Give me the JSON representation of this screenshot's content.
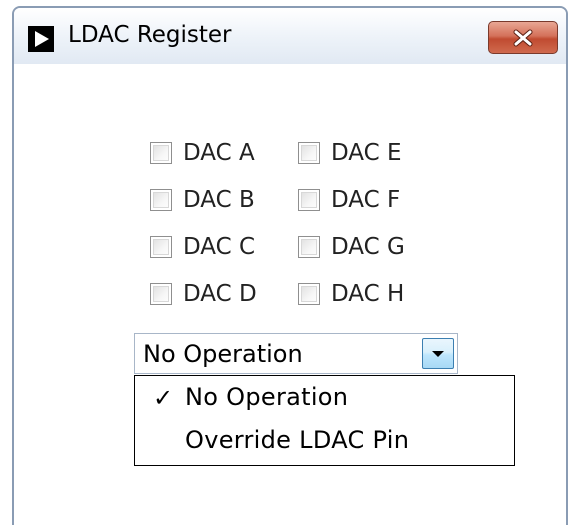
{
  "window": {
    "title": "LDAC Register",
    "icon": "play-triangle-icon",
    "close_icon": "close-x-icon"
  },
  "checkboxes": {
    "left_column": [
      {
        "label": "DAC A",
        "checked": false
      },
      {
        "label": "DAC B",
        "checked": false
      },
      {
        "label": "DAC C",
        "checked": false
      },
      {
        "label": "DAC D",
        "checked": false
      }
    ],
    "right_column": [
      {
        "label": "DAC E",
        "checked": false
      },
      {
        "label": "DAC F",
        "checked": false
      },
      {
        "label": "DAC G",
        "checked": false
      },
      {
        "label": "DAC H",
        "checked": false
      }
    ]
  },
  "combo": {
    "selected": "No Operation",
    "arrow_icon": "chevron-down-icon",
    "options": [
      {
        "label": "No Operation",
        "check_mark": "✓",
        "selected": true
      },
      {
        "label": "Override LDAC Pin",
        "check_mark": "",
        "selected": false
      }
    ]
  },
  "colors": {
    "close_button": "#c7553b",
    "combo_arrow": "#bee6fd",
    "window_border": "#8a9cb4"
  }
}
